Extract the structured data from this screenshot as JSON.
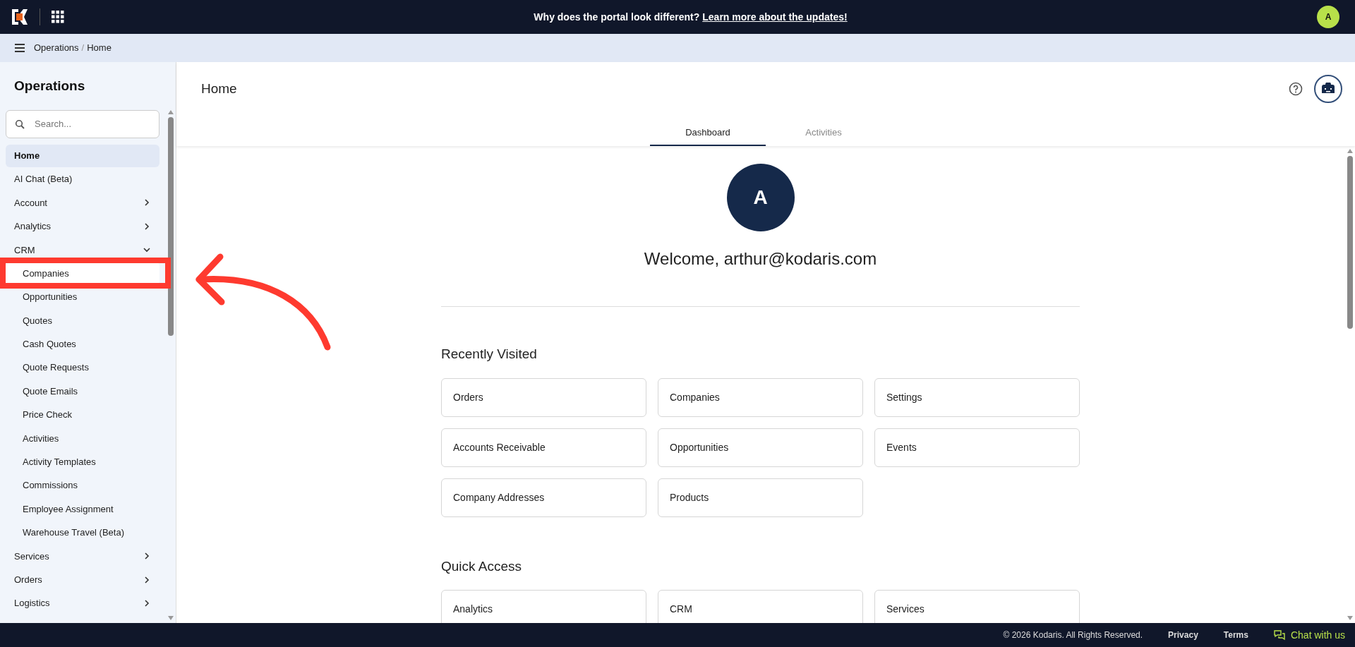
{
  "top_bar": {
    "notice": "Why does the portal look different?",
    "notice_link": "Learn more about the updates!",
    "user_initial": "A"
  },
  "breadcrumb": {
    "items": [
      "Operations",
      "Home"
    ],
    "separator": "/"
  },
  "sidebar": {
    "title": "Operations",
    "search": {
      "placeholder": "Search..."
    },
    "items": [
      {
        "label": "Home",
        "selected": true
      },
      {
        "label": "AI Chat (Beta)",
        "selected": false
      },
      {
        "label": "Account",
        "selected": false,
        "expanded": false
      },
      {
        "label": "Analytics",
        "selected": false,
        "expanded": false
      },
      {
        "label": "CRM",
        "selected": false,
        "expanded": true,
        "children": [
          {
            "label": "Companies",
            "selected": false,
            "highlighted": true
          },
          {
            "label": "Opportunities",
            "selected": false
          },
          {
            "label": "Quotes",
            "selected": false
          },
          {
            "label": "Cash Quotes",
            "selected": false
          },
          {
            "label": "Quote Requests",
            "selected": false
          },
          {
            "label": "Quote Emails",
            "selected": false
          },
          {
            "label": "Price Check",
            "selected": false
          },
          {
            "label": "Activities",
            "selected": false
          },
          {
            "label": "Activity Templates",
            "selected": false
          },
          {
            "label": "Commissions",
            "selected": false
          },
          {
            "label": "Employee Assignment",
            "selected": false
          },
          {
            "label": "Warehouse Travel (Beta)",
            "selected": false
          }
        ]
      },
      {
        "label": "Services",
        "selected": false,
        "expanded": false
      },
      {
        "label": "Orders",
        "selected": false,
        "expanded": false
      },
      {
        "label": "Logistics",
        "selected": false,
        "expanded": false
      }
    ]
  },
  "page": {
    "title": "Home",
    "tabs": [
      {
        "label": "Dashboard",
        "selected": true
      },
      {
        "label": "Activities",
        "selected": false
      }
    ],
    "avatar_initial": "A",
    "welcome": "Welcome, arthur@kodaris.com",
    "sections": [
      {
        "title": "Recently Visited",
        "links": [
          "Orders",
          "Companies",
          "Settings",
          "Accounts Receivable",
          "Opportunities",
          "Events",
          "Company Addresses",
          "Products"
        ]
      },
      {
        "title": "Quick Access",
        "links": [
          "Analytics",
          "CRM",
          "Services"
        ]
      }
    ]
  },
  "footer": {
    "copyright": "© 2026 Kodaris. All Rights Reserved.",
    "links": [
      "Privacy",
      "Terms"
    ],
    "chat": "Chat with us"
  }
}
